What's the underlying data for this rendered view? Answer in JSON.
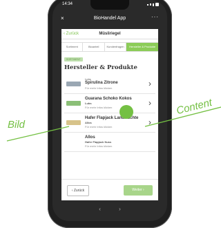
{
  "status": {
    "time": "14:34"
  },
  "appbar": {
    "close_icon": "×",
    "title": "BioHandel App",
    "more_icon": "···"
  },
  "nav": {
    "back_label": "‹ Zurück",
    "title": "Müsliriegel"
  },
  "tabs": [
    {
      "label": "Sortiment",
      "active": false
    },
    {
      "label": "Bioanteil",
      "active": false
    },
    {
      "label": "Kundenfragen",
      "active": false
    },
    {
      "label": "Hersteller & Produkte",
      "active": true
    }
  ],
  "section": {
    "badge": "SORTIMENT",
    "heading": "Hersteller & Produkte"
  },
  "products": [
    {
      "brand": "Lubs",
      "name": "Spirulina Zitrone",
      "hint": "Für mehr Infos klicken",
      "thumb_color": "#9aa7b3"
    },
    {
      "name": "Guarana Schoko Kokos",
      "brand": "Lubs",
      "hint": "Für mehr Infos klicken",
      "thumb_color": "#8bbf77"
    },
    {
      "name": "Hafer Flapjack Landfrüchte",
      "brand": "Allos",
      "hint": "Für mehr Infos klicken",
      "thumb_color": "#d7c38a"
    },
    {
      "name": "Allos",
      "brand": "Hafer Flapjack Nuss",
      "hint": "Für mehr Infos klicken"
    }
  ],
  "footer": {
    "back_label": "‹ Zurück",
    "next_label": "Weiter ›"
  },
  "annotations": {
    "image": "Bild",
    "content": "Content"
  },
  "colors": {
    "accent": "#74c043",
    "tab_active": "#8ccc58",
    "next_button": "#a8d58a"
  }
}
